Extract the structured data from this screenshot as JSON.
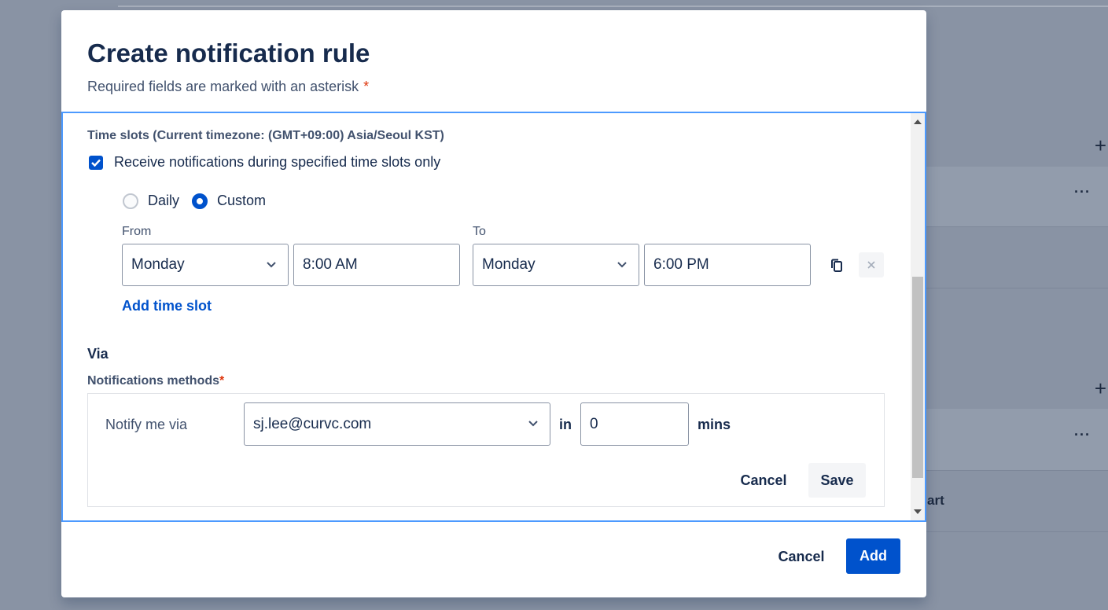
{
  "background": {
    "partial_text": "art"
  },
  "modal": {
    "title": "Create notification rule",
    "subtitle": "Required fields are marked with an asterisk",
    "asterisk": "*"
  },
  "time_slots": {
    "section_label": "Time slots (Current timezone: (GMT+09:00) Asia/Seoul KST)",
    "checkbox_label": "Receive notifications during specified time slots only",
    "checkbox_checked": true,
    "radio_options": [
      {
        "label": "Daily",
        "selected": false
      },
      {
        "label": "Custom",
        "selected": true
      }
    ],
    "from_label": "From",
    "to_label": "To",
    "from_day": "Monday",
    "from_time": "8:00 AM",
    "to_day": "Monday",
    "to_time": "6:00 PM",
    "add_slot_link": "Add time slot"
  },
  "via": {
    "heading": "Via",
    "methods_label": "Notifications methods",
    "asterisk": "*",
    "notify_label": "Notify me via",
    "notify_value": "sj.lee@curvc.com",
    "in_label": "in",
    "delay_value": "0",
    "mins_label": "mins",
    "cancel_label": "Cancel",
    "save_label": "Save"
  },
  "footer": {
    "cancel_label": "Cancel",
    "add_label": "Add"
  },
  "colors": {
    "primary": "#0052cc",
    "required": "#de350b",
    "focus_border": "#4c9aff"
  }
}
